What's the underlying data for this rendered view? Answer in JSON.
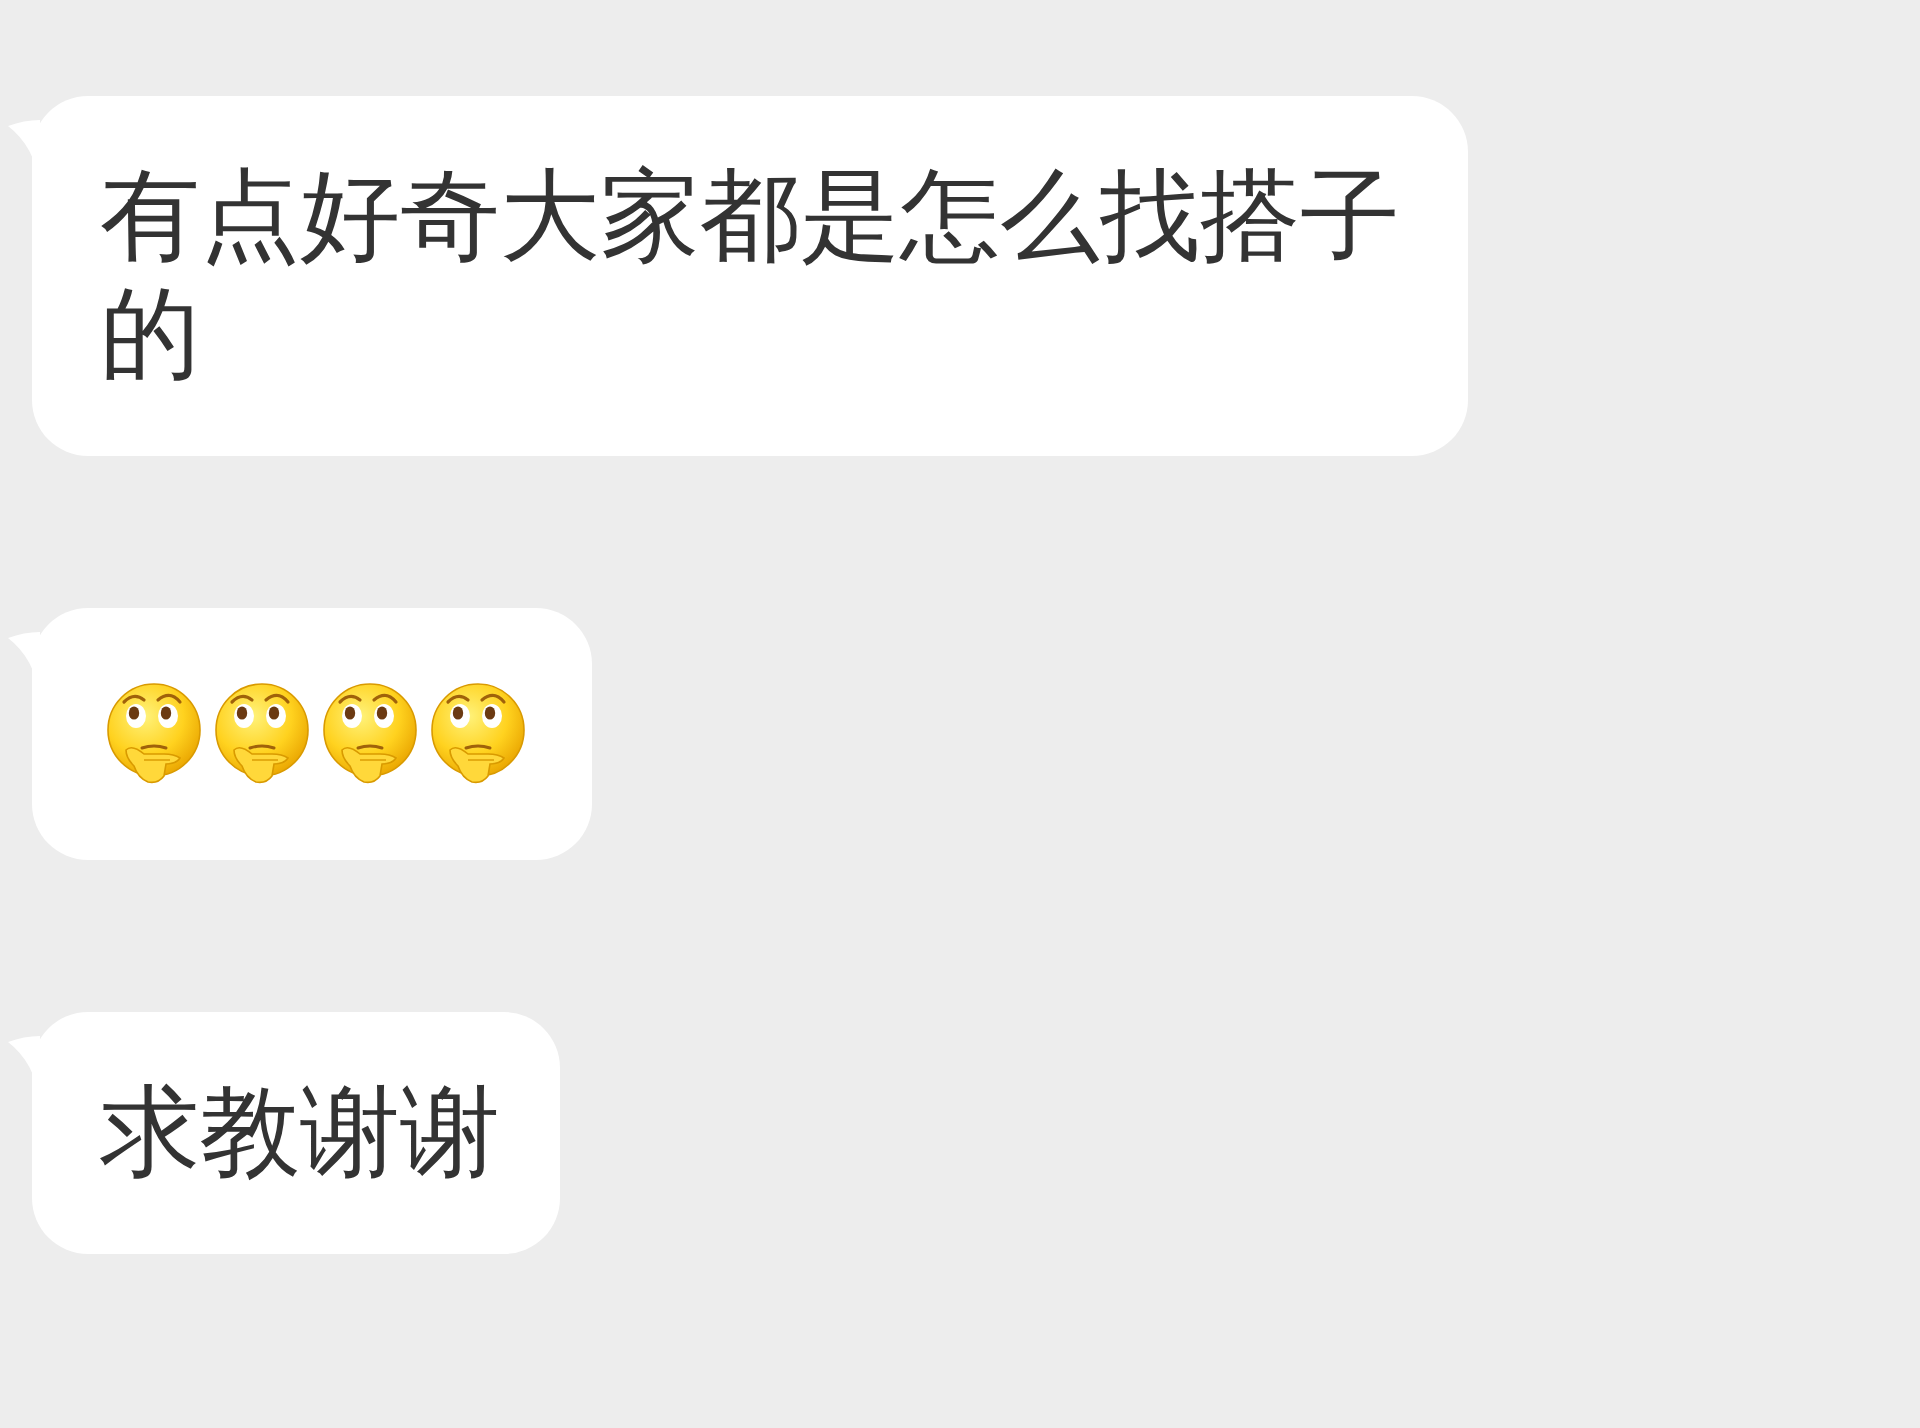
{
  "messages": [
    {
      "kind": "text",
      "text": "有点好奇大家都是怎么找搭子的"
    },
    {
      "kind": "emoji",
      "emojis": [
        {
          "kind": "thinking-face"
        },
        {
          "kind": "thinking-face"
        },
        {
          "kind": "thinking-face"
        },
        {
          "kind": "thinking-face"
        }
      ]
    },
    {
      "kind": "text",
      "text": "求教谢谢"
    }
  ]
}
